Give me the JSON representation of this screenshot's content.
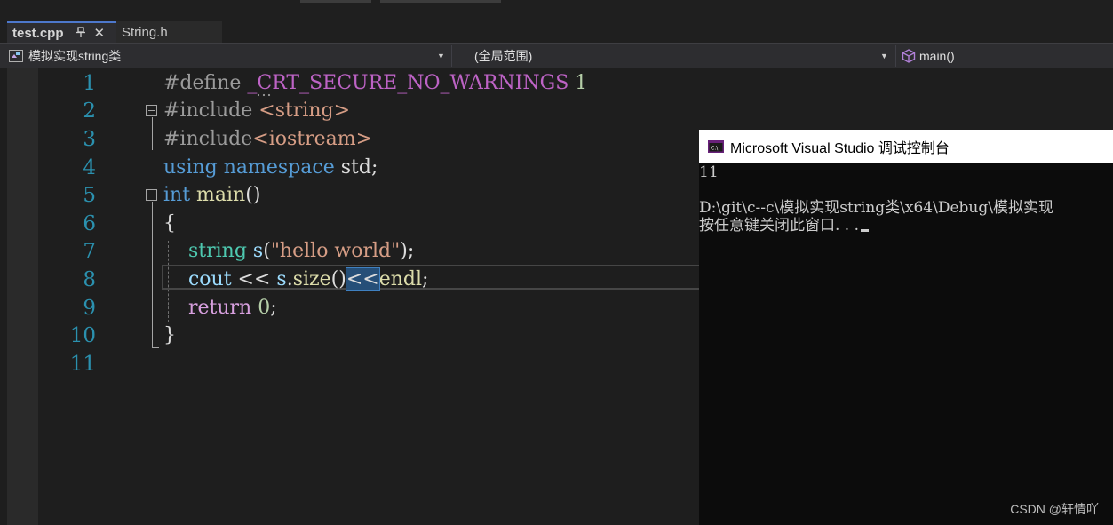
{
  "tabs": [
    {
      "label": "test.cpp",
      "active": true,
      "pin_glyph": "↑",
      "close_glyph": "✕"
    },
    {
      "label": "String.h",
      "active": false
    }
  ],
  "navbar": {
    "project": "模拟实现string类",
    "scope": "(全局范围)",
    "member": "main()"
  },
  "editor": {
    "line_numbers": [
      "1",
      "2",
      "3",
      "4",
      "5",
      "6",
      "7",
      "8",
      "9",
      "10",
      "11"
    ],
    "tokens": {
      "l1_define": "#define ",
      "l1_macro": "_CRT_SECURE_NO_WARNINGS",
      "l1_value": " 1",
      "l2_include": "#include ",
      "l2_header": "<string>",
      "l3_include": "#include",
      "l3_header": "<iostream>",
      "l4_using": "using",
      "l4_namespace": " namespace",
      "l4_std": " std;",
      "l5_int": "int",
      "l5_main": " main",
      "l5_paren": "()",
      "l6_brace": "{",
      "l7_indent": "    ",
      "l7_type": "string",
      "l7_var": " s",
      "l7_open": "(",
      "l7_str": "\"hello world\"",
      "l7_close": ");",
      "l8_indent": "    ",
      "l8_cout": "cout",
      "l8_op1": " << ",
      "l8_s": "s",
      "l8_dot": ".",
      "l8_size": "size",
      "l8_paren": "()",
      "l8_op2": "<<",
      "l8_endl": "endl",
      "l8_semi": ";",
      "l9_indent": "    ",
      "l9_return": "return",
      "l9_zero": " 0",
      "l9_semi": ";",
      "l10_brace": "}"
    }
  },
  "console": {
    "title": "Microsoft Visual Studio 调试控制台",
    "output": "11",
    "path_line": "D:\\git\\c--c\\模拟实现string类\\x64\\Debug\\模拟实现",
    "prompt_line": "按任意键关闭此窗口. . ."
  },
  "watermark": "CSDN @轩情吖",
  "colors": {
    "keyword": "#569cd6",
    "type": "#4ec9b0",
    "string": "#d69d85",
    "function": "#dcdcaa",
    "macro": "#bd63c5",
    "line_number": "#2b91af",
    "tab_accent": "#4d78cc"
  },
  "icons": {
    "project": "class-icon",
    "member": "method-cube-icon",
    "console": "console-app-icon"
  }
}
